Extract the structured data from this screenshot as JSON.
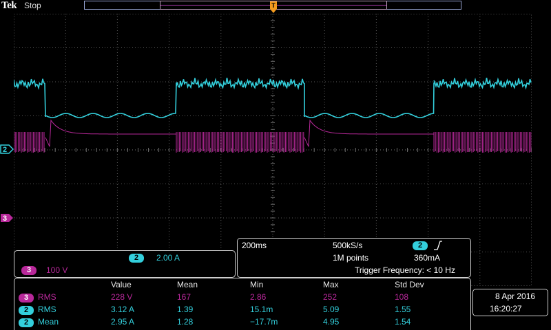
{
  "brand": "Tek",
  "acquisition_state": "Stop",
  "trigger_marker": "T",
  "channels": {
    "ch2": {
      "number": "2",
      "color": "#33cfdc",
      "scale": "2.00 A"
    },
    "ch3": {
      "number": "3",
      "color": "#b8289a",
      "scale": "100 V"
    }
  },
  "horizontal": {
    "time_per_div": "200ms",
    "sample_rate": "500kS/s",
    "record_length": "1M points",
    "trigger_source": "2",
    "trigger_slope_icon": "rising-edge-icon",
    "trigger_level": "360mA",
    "trigger_frequency": "Trigger Frequency: < 10 Hz"
  },
  "measurements": {
    "headers": [
      "Value",
      "Mean",
      "Min",
      "Max",
      "Std Dev"
    ],
    "rows": [
      {
        "channel": "3",
        "type": "RMS",
        "value": "228 V",
        "mean": "167",
        "min": "2.86",
        "max": "252",
        "std": "108"
      },
      {
        "channel": "2",
        "type": "RMS",
        "value": "3.12 A",
        "mean": "1.39",
        "min": "15.1m",
        "max": "5.09",
        "std": "1.55"
      },
      {
        "channel": "2",
        "type": "Mean",
        "value": "2.95 A",
        "mean": "1.28",
        "min": "−17.7m",
        "max": "4.95",
        "std": "1.54"
      }
    ]
  },
  "datetime": {
    "date": "8 Apr  2016",
    "time": "16:20:27"
  }
}
